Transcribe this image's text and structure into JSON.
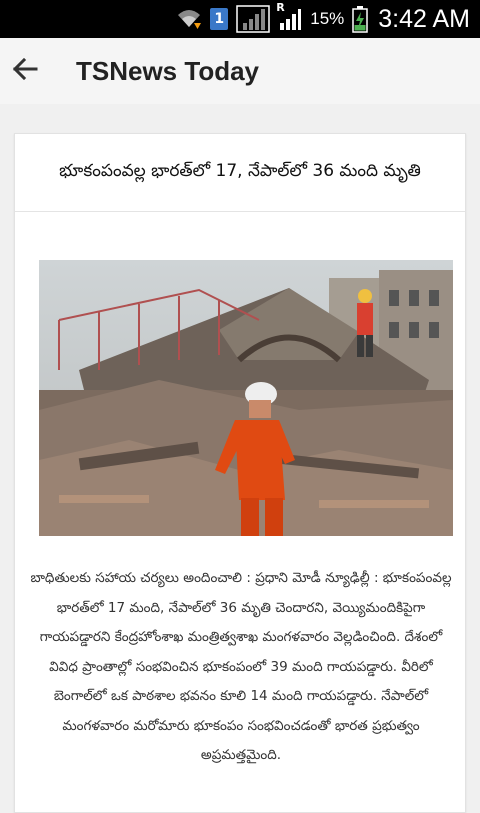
{
  "status_bar": {
    "wifi_icon": "wifi-icon",
    "sim_badge": "1",
    "network_letter": "R",
    "battery_percent": "15%",
    "time": "3:42 AM"
  },
  "app_bar": {
    "title": "TSNews Today",
    "back_icon": "arrow-left-icon"
  },
  "article": {
    "headline": "భూకంపంవల్ల భారత్‌లో 17, నేపాల్‌లో 36 మంది మృతి",
    "image_description": "earthquake-rubble-rescuer-photo",
    "body": "బాధితులకు సహాయ చర్యలు అందించాలి : ప్రధాని మోడీ న్యూఢిల్లీ : భూకంపంవల్ల భారత్‌లో 17 మంది, నేపాల్‌లో 36 మృతి చెందారని, వెయ్యిమందికిపైగా గాయపడ్డారని కేంద్రహోంశాఖ మంత్రిత్వశాఖ మంగళవారం వెల్లడించింది. దేశంలో వివిధ ప్రాంతాల్లో సంభవించిన భూకంపంలో 39 మంది గాయపడ్డారు. వీరిలో బెంగాల్‌లో ఒక పాఠశాల భవనం కూలి 14 మంది గాయపడ్డారు. నేపాల్‌లో మంగళవారం మరోమారు భూకంపం సంభవించడంతో భారత ప్రభుత్వం అప్రమత్తమైంది."
  },
  "colors": {
    "status_bar_bg": "#000000",
    "app_bar_bg": "#f5f5f5",
    "page_bg": "#f0f0f0",
    "card_bg": "#ffffff",
    "sim_badge": "#3a78c8",
    "battery_charging": "#4caf50"
  }
}
